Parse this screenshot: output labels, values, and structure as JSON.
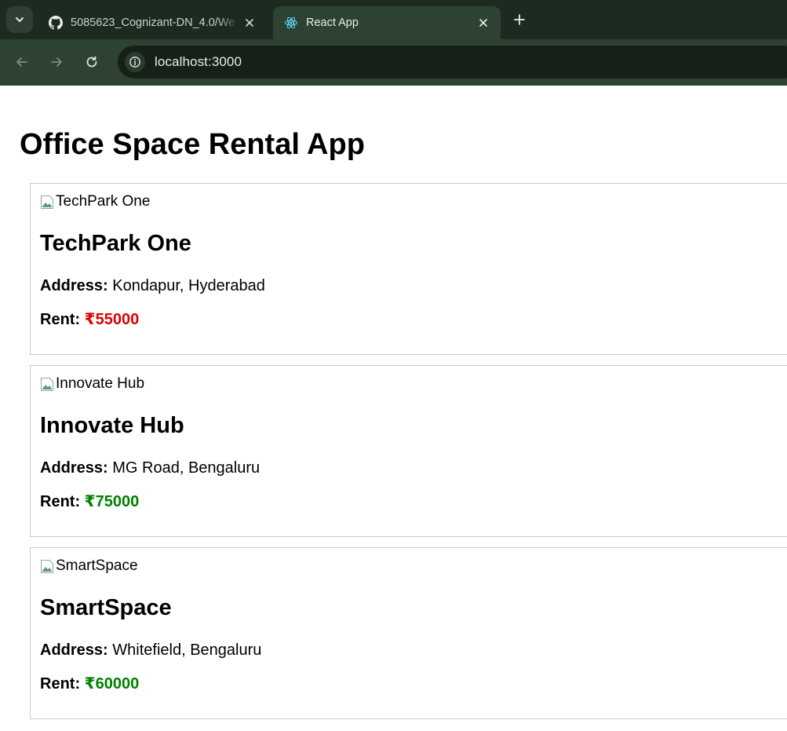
{
  "browser": {
    "tabs": [
      {
        "title": "5085623_Cognizant-DN_4.0/We",
        "icon": "github-icon",
        "active": false
      },
      {
        "title": "React App",
        "icon": "react-icon",
        "active": true
      }
    ],
    "url": "localhost:3000"
  },
  "page": {
    "title": "Office Space Rental App",
    "address_label": "Address:",
    "rent_label": "Rent:",
    "offices": [
      {
        "image_alt": "TechPark One",
        "name": "TechPark One",
        "address": "Kondapur, Hyderabad",
        "rent": "₹55000",
        "rent_color": "#e00000"
      },
      {
        "image_alt": "Innovate Hub",
        "name": "Innovate Hub",
        "address": "MG Road, Bengaluru",
        "rent": "₹75000",
        "rent_color": "#008000"
      },
      {
        "image_alt": "SmartSpace",
        "name": "SmartSpace",
        "address": "Whitefield, Bengaluru",
        "rent": "₹60000",
        "rent_color": "#008000"
      }
    ]
  },
  "colors": {
    "tabstrip_bg": "#1c2a1f",
    "toolbar_bg": "#2e4233",
    "rent_low": "#e00000",
    "rent_high": "#008000"
  }
}
